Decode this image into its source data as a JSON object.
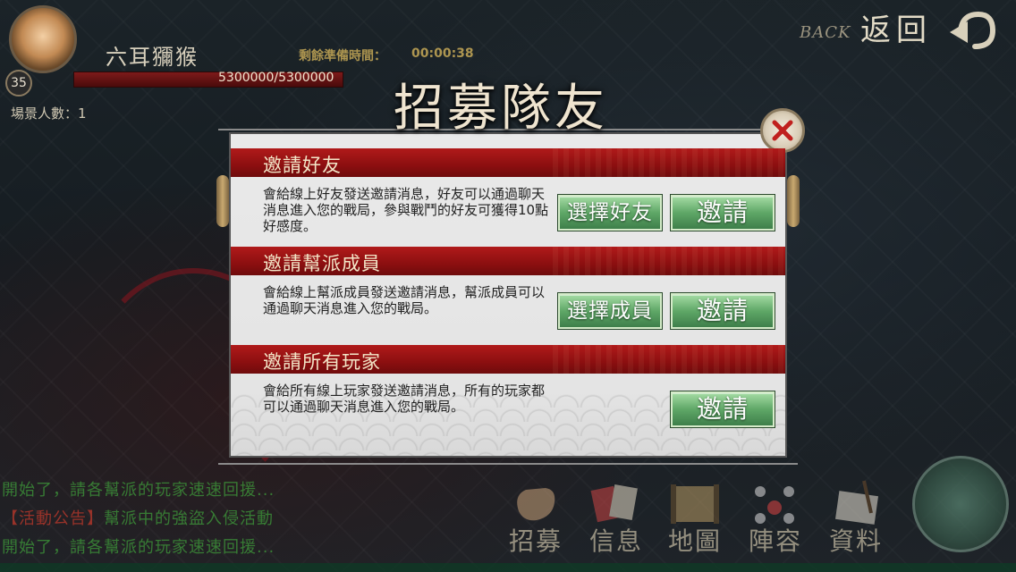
{
  "hud": {
    "player_name": "六耳獼猴",
    "level": "35",
    "hp_text": "5300000/5300000",
    "scene_count": "場景人數：1",
    "prep_label": "剩餘準備時間：",
    "prep_time": "00:00:38",
    "hp_fraction": 1.0
  },
  "back": {
    "en": "BACK",
    "zh": "返回"
  },
  "dialog": {
    "title": "招募隊友",
    "sections": [
      {
        "title": "邀請好友",
        "description": "會給線上好友發送邀請消息，好友可以通過聊天消息進入您的戰局，參與戰鬥的好友可獲得10點好感度。",
        "select_label": "選擇好友",
        "invite_label": "邀請"
      },
      {
        "title": "邀請幫派成員",
        "description": "會給線上幫派成員發送邀請消息，幫派成員可以通過聊天消息進入您的戰局。",
        "select_label": "選擇成員",
        "invite_label": "邀請"
      },
      {
        "title": "邀請所有玩家",
        "description": "會給所有線上玩家發送邀請消息，所有的玩家都可以通過聊天消息進入您的戰局。",
        "invite_label": "邀請"
      }
    ]
  },
  "chat": [
    {
      "text": "開始了，請各幫派的玩家速速回援...",
      "color": "#3e9a3a"
    },
    {
      "tag": "【活動公告】",
      "text": "幫派中的強盜入侵活動",
      "color": "#3e9a3a",
      "tag_color": "#c0392b"
    },
    {
      "text": "開始了，請各幫派的玩家速速回援...",
      "color": "#3e9a3a"
    }
  ],
  "menu": [
    {
      "label": "招募",
      "icon": "fist-icon"
    },
    {
      "label": "信息",
      "icon": "cards-icon"
    },
    {
      "label": "地圖",
      "icon": "map-scroll-icon"
    },
    {
      "label": "陣容",
      "icon": "formation-icon"
    },
    {
      "label": "資料",
      "icon": "brush-paper-icon"
    }
  ],
  "colors": {
    "header_red": "#8c0f10",
    "button_green": "#5fa767",
    "dialog_bg": "#e6e6e6",
    "chat_green": "#3e9a3a"
  }
}
